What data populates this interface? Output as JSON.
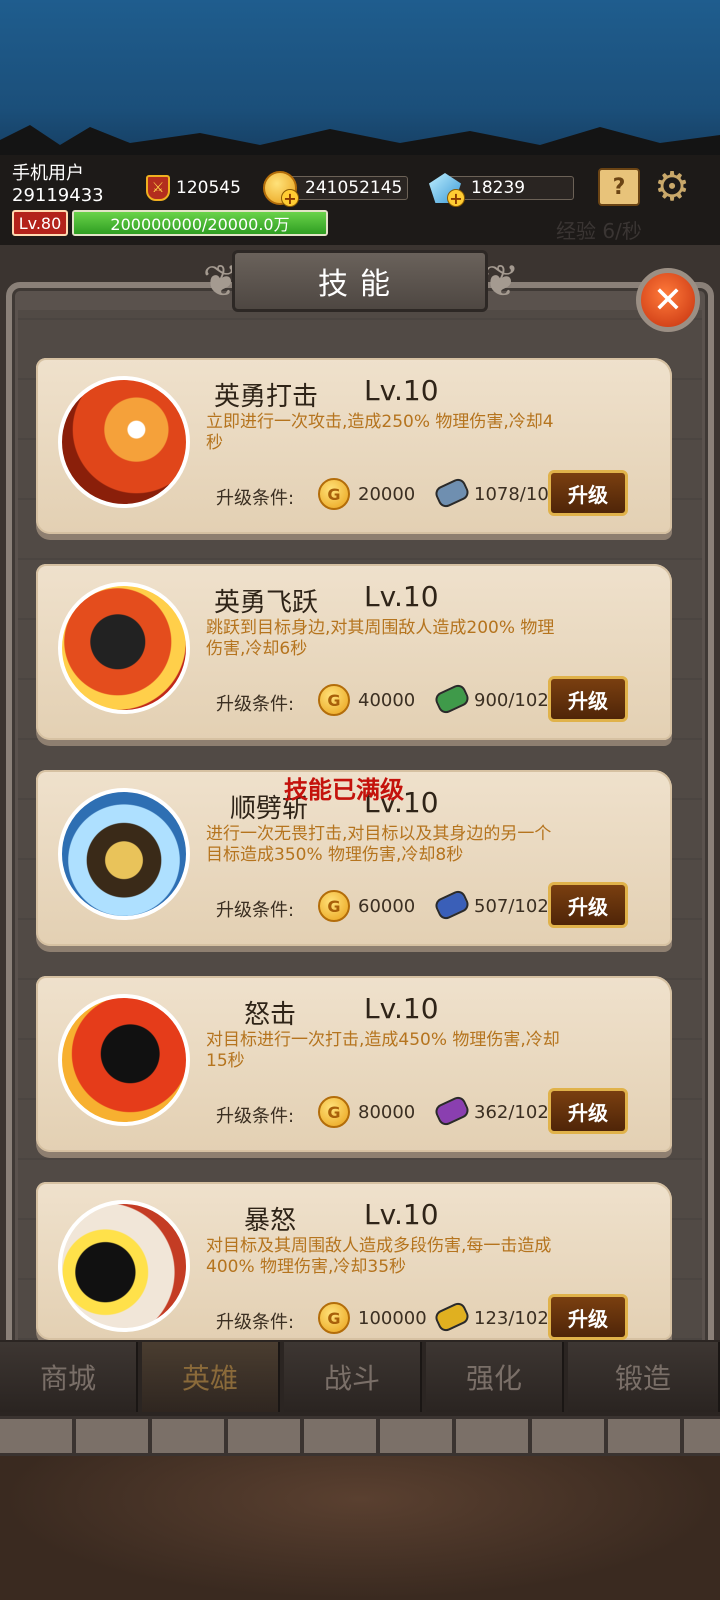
{
  "user": {
    "name": "手机用户",
    "id": "29119433",
    "level": "Lv.80",
    "exp_text": "200000000/20000.0万",
    "exp_fraction": 1.0
  },
  "resources": {
    "power": "120545",
    "gold": "241052145",
    "gems": "18239"
  },
  "exp_rate": "经验 6/秒",
  "panel": {
    "title": "技能"
  },
  "skills": [
    {
      "name": "英勇打击",
      "level": "Lv.10",
      "desc": "立即进行一次攻击,造成250% 物理伤害,冷却4秒",
      "cond_label": "升级条件:",
      "gold_cost": "20000",
      "fragments": "1078/10",
      "scroll_color": "#6f8fb0",
      "button": "升级"
    },
    {
      "name": "英勇飞跃",
      "level": "Lv.10",
      "desc": "跳跃到目标身边,对其周围敌人造成200% 物理伤害,冷却6秒",
      "cond_label": "升级条件:",
      "gold_cost": "40000",
      "fragments": "900/102",
      "scroll_color": "#3f9a4a",
      "button": "升级"
    },
    {
      "name": "顺劈斩",
      "level": "Lv.10",
      "desc": "进行一次无畏打击,对目标以及其身边的另一个目标造成350% 物理伤害,冷却8秒",
      "cond_label": "升级条件:",
      "gold_cost": "60000",
      "fragments": "507/102",
      "scroll_color": "#3a5fb8",
      "button": "升级"
    },
    {
      "name": "怒击",
      "level": "Lv.10",
      "desc": "对目标进行一次打击,造成450% 物理伤害,冷却15秒",
      "cond_label": "升级条件:",
      "gold_cost": "80000",
      "fragments": "362/102",
      "scroll_color": "#8a3fb0",
      "button": "升级"
    },
    {
      "name": "暴怒",
      "level": "Lv.10",
      "desc": "对目标及其周围敌人造成多段伤害,每一击造成 400% 物理伤害,冷却35秒",
      "cond_label": "升级条件:",
      "gold_cost": "100000",
      "fragments": "123/102",
      "scroll_color": "#e0b020",
      "button": "升级"
    }
  ],
  "maxed_notice": "技能已满级",
  "nav": [
    "商城",
    "英雄",
    "战斗",
    "强化",
    "锻造"
  ],
  "nav_active": "英雄"
}
